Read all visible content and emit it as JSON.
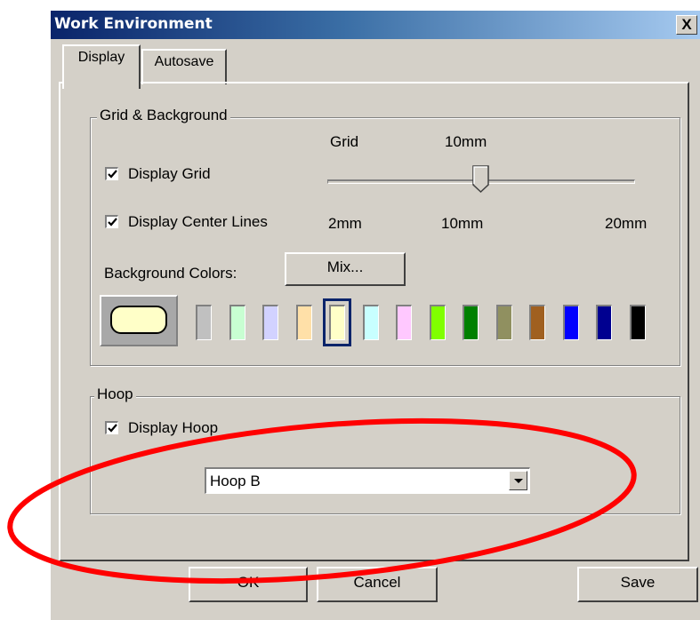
{
  "window": {
    "title": "Work Environment",
    "close_label": "X"
  },
  "tabs": [
    {
      "label": "Display",
      "active": true
    },
    {
      "label": "Autosave",
      "active": false
    }
  ],
  "grid_background": {
    "legend": "Grid & Background",
    "display_grid": {
      "label": "Display Grid",
      "checked": true
    },
    "display_center_lines": {
      "label": "Display Center Lines",
      "checked": true
    },
    "grid_slider": {
      "caption": "Grid",
      "current_value": "10mm",
      "min_label": "2mm",
      "mid_label": "10mm",
      "max_label": "20mm",
      "value_fraction": 0.5
    },
    "background_colors_label": "Background Colors:",
    "mix_button": "Mix...",
    "preview_color": "#ffffc8",
    "selected_index": 4,
    "colors": [
      "#c0c0c0",
      "#c8ffd2",
      "#d2d2ff",
      "#ffe0a8",
      "#ffffc8",
      "#c8ffff",
      "#ffc8ff",
      "#80ff00",
      "#008000",
      "#909060",
      "#a06020",
      "#0000ff",
      "#000090",
      "#000000"
    ]
  },
  "hoop": {
    "legend": "Hoop",
    "display_hoop": {
      "label": "Display Hoop",
      "checked": true
    },
    "selected": "Hoop B"
  },
  "buttons": {
    "ok": "OK",
    "cancel": "Cancel",
    "save": "Save"
  },
  "annotation_color": "#ff0000"
}
